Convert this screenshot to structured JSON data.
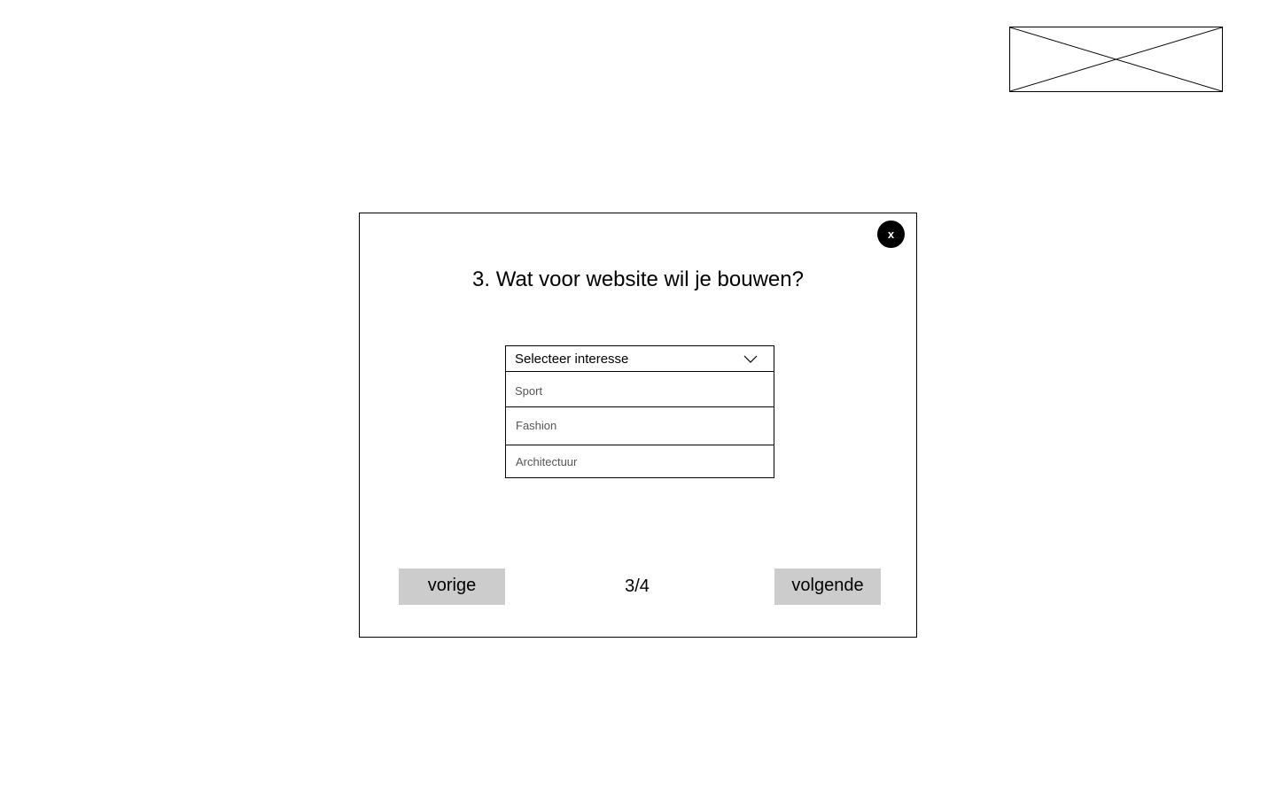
{
  "logo": {
    "icon": "image-placeholder-icon"
  },
  "modal": {
    "close_label": "x",
    "question": "3. Wat voor website wil je bouwen?",
    "dropdown": {
      "placeholder": "Selecteer interesse",
      "icon": "chevron-down-icon",
      "options": [
        {
          "label": "Sport"
        },
        {
          "label": "Fashion"
        },
        {
          "label": "Architectuur"
        }
      ]
    },
    "prev_label": "vorige",
    "step": "3/4",
    "next_label": "volgende"
  },
  "colors": {
    "button_bg": "#cccccc",
    "close_bg": "#000000",
    "option_text": "#555555"
  }
}
